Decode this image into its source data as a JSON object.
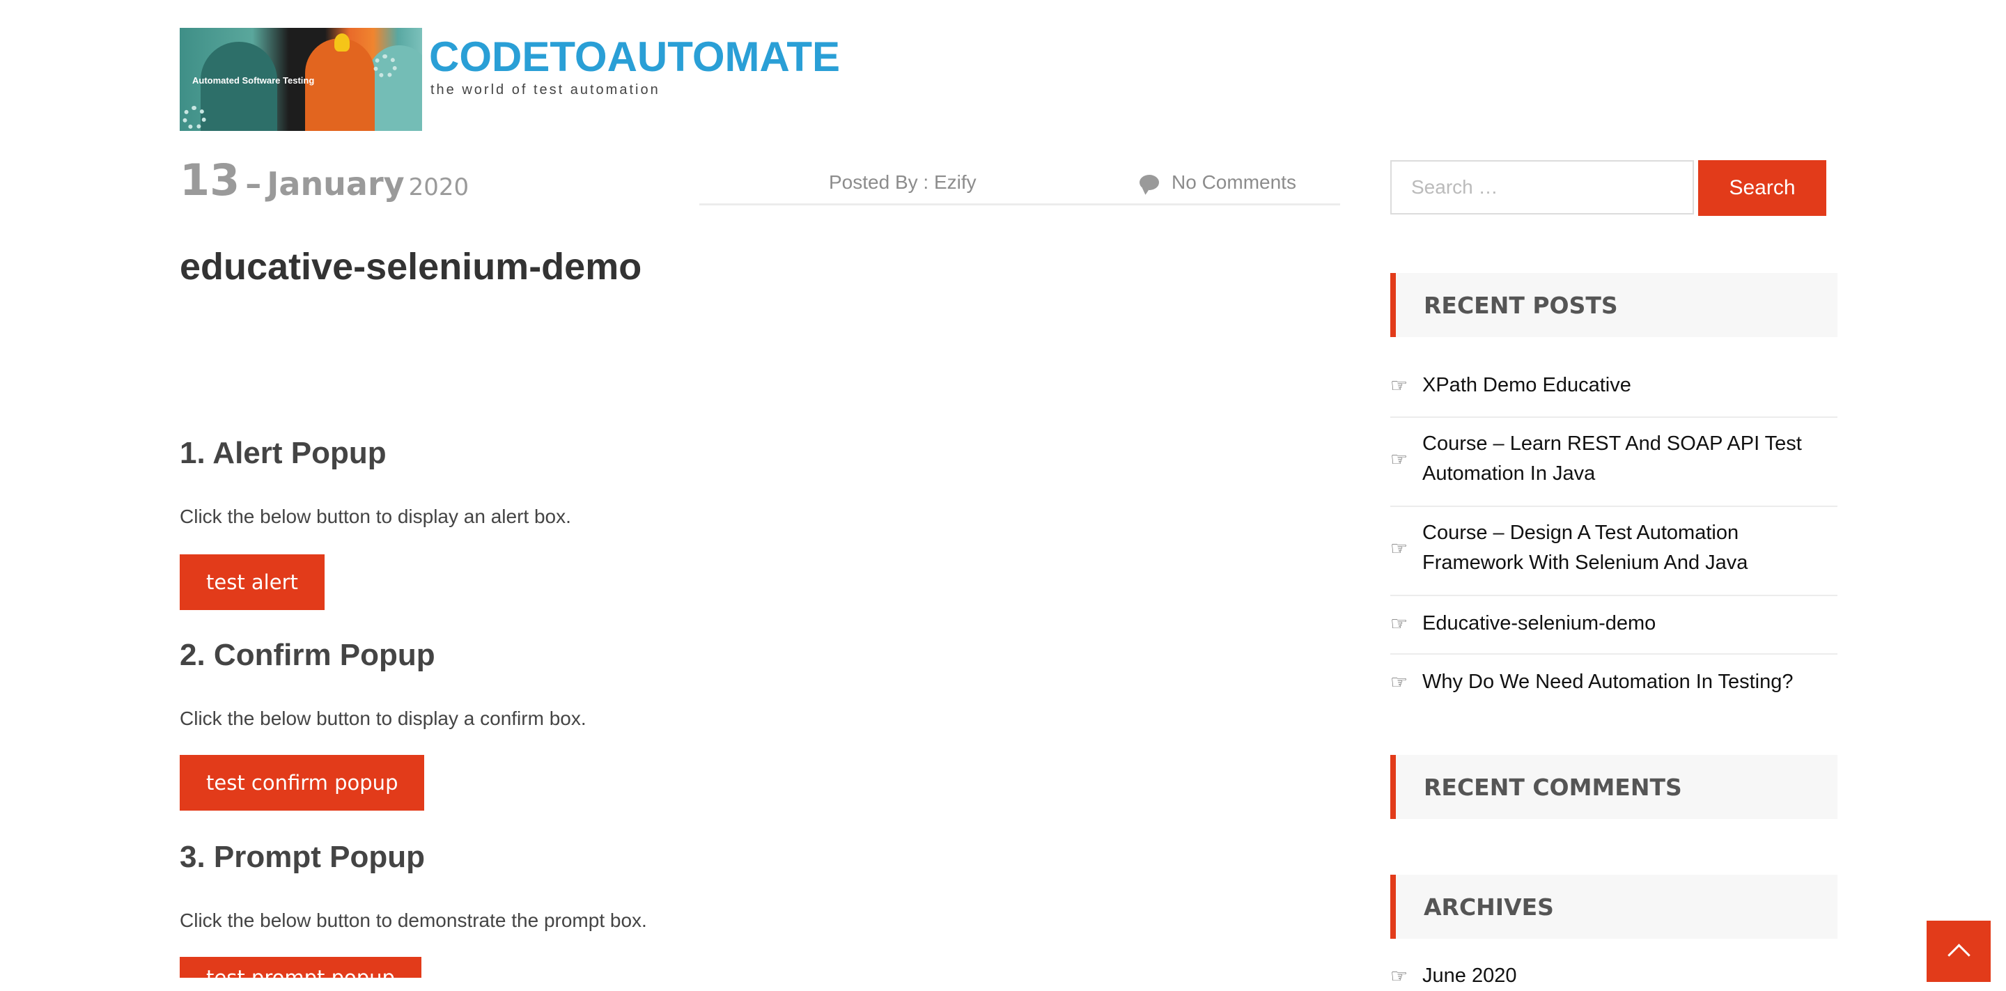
{
  "header": {
    "logo_caption": "Automated Software Testing",
    "site_title": "CODETOAUTOMATE",
    "tagline": "the world of test automation"
  },
  "post": {
    "day": "13",
    "dash": "–",
    "month": "January",
    "year": "2020",
    "posted_by": "Posted By : Ezify",
    "comments": "No Comments",
    "title": "educative-selenium-demo"
  },
  "sections": [
    {
      "heading": "1. Alert Popup",
      "text": "Click the below button to display an alert box.",
      "button": "test alert"
    },
    {
      "heading": "2. Confirm Popup",
      "text": "Click the below button to display a confirm box.",
      "button": "test confirm popup"
    },
    {
      "heading": "3. Prompt Popup",
      "text": "Click the below button to demonstrate the prompt box.",
      "button": "test prompt popup"
    }
  ],
  "sidebar": {
    "search_placeholder": "Search …",
    "search_button": "Search",
    "recent_posts_title": "RECENT POSTS",
    "recent_posts": [
      "XPath Demo Educative",
      "Course – Learn REST And SOAP API Test Automation In Java",
      "Course – Design A Test Automation Framework With Selenium And Java",
      "Educative-selenium-demo",
      "Why Do We Need Automation In Testing?"
    ],
    "recent_comments_title": "RECENT COMMENTS",
    "archives_title": "ARCHIVES",
    "archives": [
      "June 2020"
    ]
  },
  "icons": {
    "hand": "pointing-hand-icon",
    "comment": "chat-bubble-icon",
    "back_to_top": "chevron-up-icon"
  },
  "colors": {
    "accent": "#e23b1a",
    "brand_blue": "#2a9fd6"
  }
}
